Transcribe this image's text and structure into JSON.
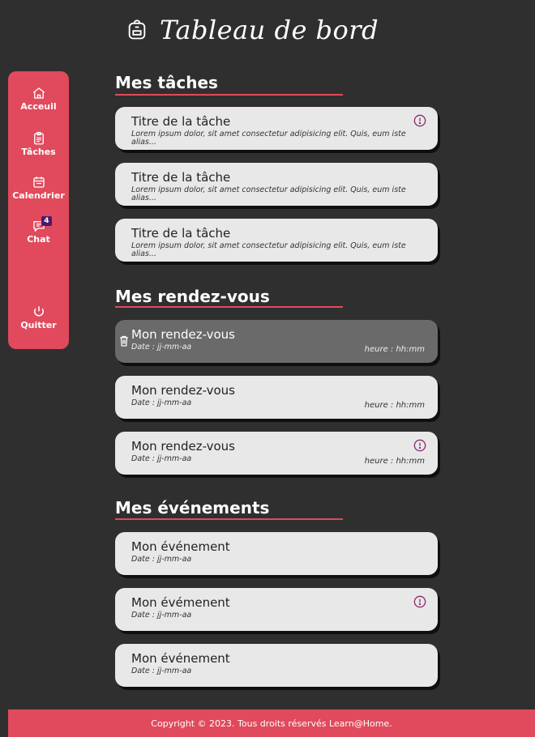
{
  "header": {
    "title": "Tableau de bord",
    "icon": "backpack-icon"
  },
  "sidebar": {
    "items": [
      {
        "label": "Acceuil",
        "icon": "home-icon"
      },
      {
        "label": "Tâches",
        "icon": "clipboard-icon"
      },
      {
        "label": "Calendrier",
        "icon": "calendar-icon"
      },
      {
        "label": "Chat",
        "icon": "chat-icon",
        "badge": "4"
      },
      {
        "label": "Quitter",
        "icon": "power-icon"
      }
    ]
  },
  "tasks": {
    "title": "Mes tâches",
    "items": [
      {
        "title": "Titre de la tâche",
        "desc": "Lorem ipsum dolor, sit amet consectetur adipisicing elit. Quis, eum iste alias...",
        "alert": true
      },
      {
        "title": "Titre de la tâche",
        "desc": "Lorem ipsum dolor, sit amet consectetur adipisicing elit. Quis, eum iste alias...",
        "alert": false
      },
      {
        "title": "Titre de la tâche",
        "desc": "Lorem ipsum dolor, sit amet consectetur adipisicing elit. Quis, eum iste alias...",
        "alert": false
      }
    ]
  },
  "appointments": {
    "title": "Mes rendez-vous",
    "items": [
      {
        "title": "Mon rendez-vous",
        "date": "Date : jj-mm-aa",
        "time": "heure : hh:mm",
        "selected": true
      },
      {
        "title": "Mon rendez-vous",
        "date": "Date : jj-mm-aa",
        "time": "heure : hh:mm",
        "selected": false
      },
      {
        "title": "Mon rendez-vous",
        "date": "Date : jj-mm-aa",
        "time": "heure : hh:mm",
        "alert": true
      }
    ]
  },
  "events": {
    "title": "Mes événements",
    "items": [
      {
        "title": "Mon événement",
        "date": "Date : jj-mm-aa"
      },
      {
        "title": "Mon évémenent",
        "date": "Date : jj-mm-aa",
        "alert": true
      },
      {
        "title": "Mon événement",
        "date": "Date : jj-mm-aa"
      }
    ]
  },
  "footer": {
    "text": "Copyright © 2023. Tous droits réservés Learn@Home."
  },
  "colors": {
    "accent": "#e04a5c",
    "background": "#2f2f2f",
    "card": "#e8e8e8",
    "selected": "#6a6a6a",
    "alert": "#8e2a6e"
  }
}
